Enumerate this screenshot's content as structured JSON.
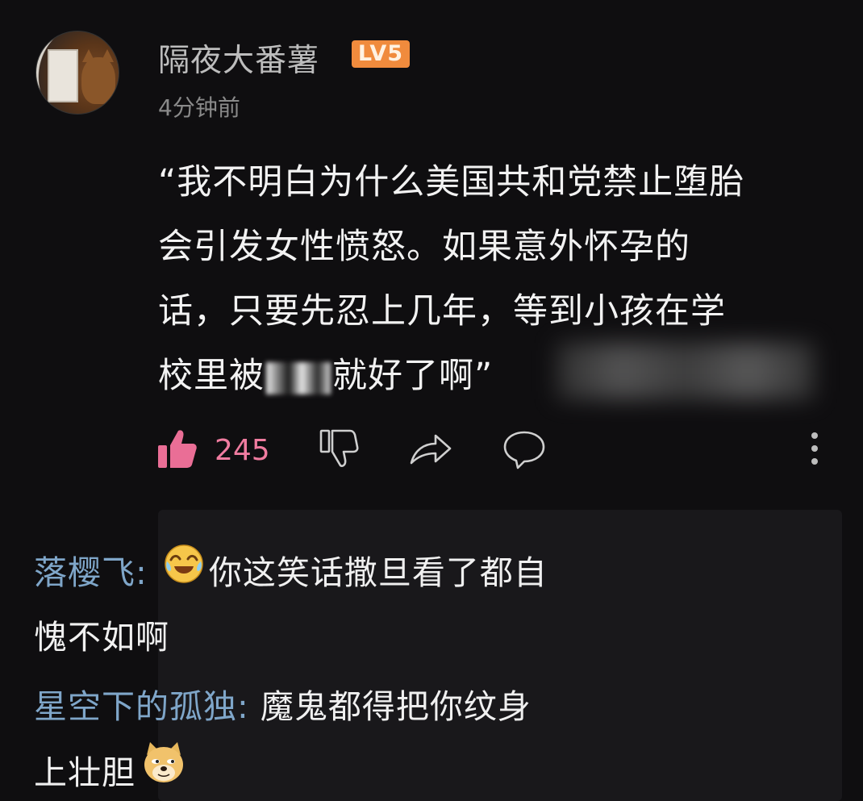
{
  "comment": {
    "username": "隔夜大番薯",
    "level": "LV5",
    "timestamp": "4分钟前",
    "lines": [
      "“我不明白为什么美国共和党禁止堕胎",
      "会引发女性愤怒。如果意外怀孕的",
      "话，只要先忍上几年，等到小孩在学"
    ],
    "line4_before": "校里被",
    "line4_after": "就好了啊”",
    "like_count": "245"
  },
  "replies": [
    {
      "name": "落樱飞",
      "separator": ": ",
      "emoji": "crying-laughing-emoji",
      "text_line1": "你这笑话撒旦看了都自",
      "text_line2": "愧不如啊"
    },
    {
      "name": "星空下的孤独",
      "separator": ": ",
      "text_line1": "魔鬼都得把你纹身",
      "text_line2": "上壮胆",
      "emoji": "doge-emoji"
    }
  ],
  "colors": {
    "background": "#0f0e10",
    "reply_background": "#19181b",
    "username": "#bdbdbd",
    "badge": "#f08b3d",
    "like_accent": "#f07ca0",
    "reply_name": "#7fa6c9",
    "text": "#f2f2f2"
  }
}
